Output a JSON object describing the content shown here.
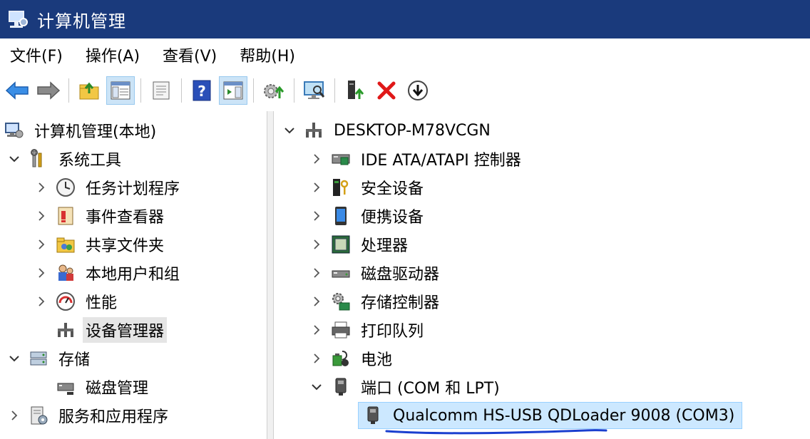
{
  "window": {
    "title": "计算机管理"
  },
  "menu": [
    "文件(F)",
    "操作(A)",
    "查看(V)",
    "帮助(H)"
  ],
  "toolbar": {
    "buttons": [
      "back-icon",
      "forward-icon",
      "up-folder-icon",
      "show-hide-tree-icon",
      "properties-icon",
      "help-icon",
      "show-hide-action-icon",
      "update-driver-icon",
      "scan-hardware-icon",
      "enable-device-icon",
      "uninstall-icon",
      "disable-device-icon"
    ]
  },
  "left_tree": {
    "root": "计算机管理(本地)",
    "system_tools": "系统工具",
    "task_scheduler": "任务计划程序",
    "event_viewer": "事件查看器",
    "shared_folders": "共享文件夹",
    "local_users": "本地用户和组",
    "performance": "性能",
    "device_manager": "设备管理器",
    "storage": "存储",
    "disk_management": "磁盘管理",
    "services_apps": "服务和应用程序"
  },
  "right_tree": {
    "computer": "DESKTOP-M78VCGN",
    "ide": "IDE ATA/ATAPI 控制器",
    "security": "安全设备",
    "portable": "便携设备",
    "processor": "处理器",
    "disk_drives": "磁盘驱动器",
    "storage_ctrl": "存储控制器",
    "print_queue": "打印队列",
    "battery": "电池",
    "ports": "端口 (COM 和 LPT)",
    "qualcomm": "Qualcomm HS-USB QDLoader 9008 (COM3)"
  },
  "colors": {
    "titlebar": "#1a3a7c",
    "selection": "#cce8ff",
    "annotation": "#1a3fcf"
  }
}
